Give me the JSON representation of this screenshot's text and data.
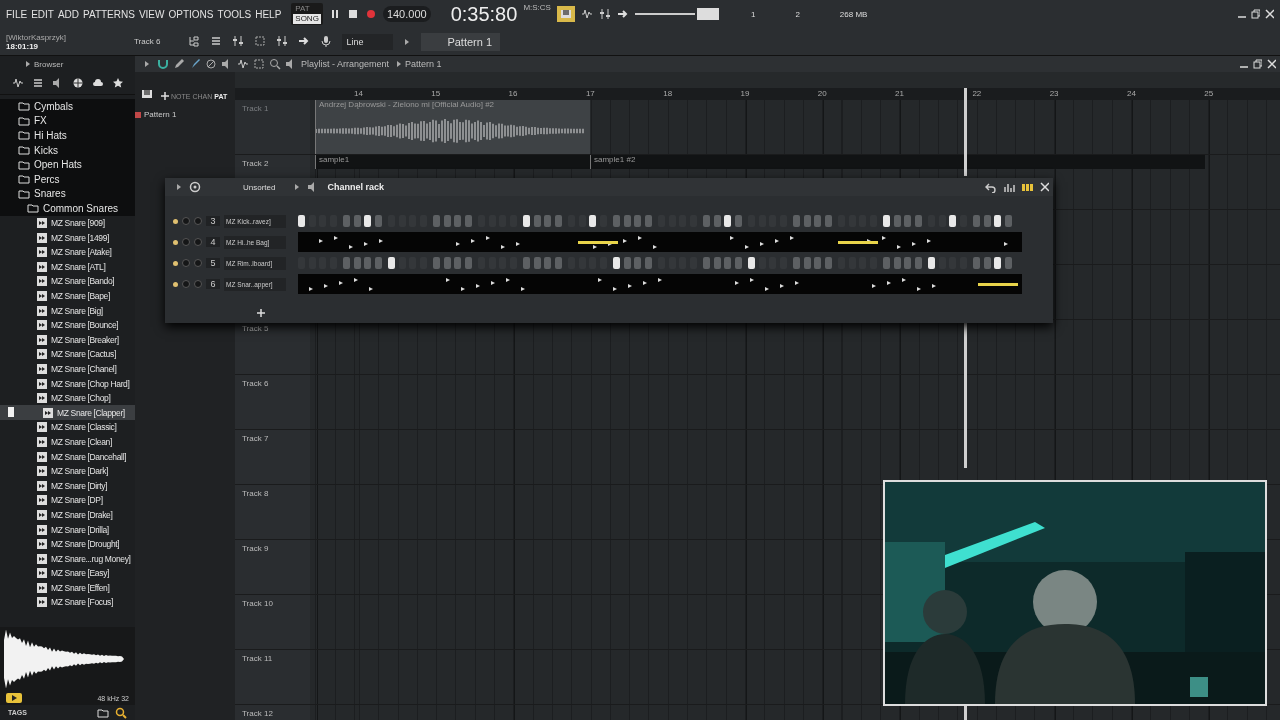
{
  "menu": [
    "FILE",
    "EDIT",
    "ADD",
    "PATTERNS",
    "VIEW",
    "OPTIONS",
    "TOOLS",
    "HELP"
  ],
  "transport": {
    "modes": [
      {
        "label": "PAT",
        "selected": false
      },
      {
        "label": "SONG",
        "selected": true
      }
    ],
    "tempo": "140.000",
    "time": "0:35:80",
    "time_format": "M:S:CS"
  },
  "monitor": {
    "marks": [
      "1",
      "2"
    ],
    "memory": "268 MB"
  },
  "session": {
    "user": "[WiktorKasprzyk]",
    "clock": "18:01:19",
    "focused_track": "Track 6",
    "input": "Line",
    "pattern": "Pattern 1"
  },
  "browser": {
    "title": "Browser",
    "tree": [
      {
        "label": "Cymbals",
        "kind": "folder",
        "selected": false
      },
      {
        "label": "FX",
        "kind": "folder",
        "selected": false
      },
      {
        "label": "Hi Hats",
        "kind": "folder",
        "selected": false
      },
      {
        "label": "Kicks",
        "kind": "folder",
        "selected": false
      },
      {
        "label": "Open Hats",
        "kind": "folder",
        "selected": false
      },
      {
        "label": "Percs",
        "kind": "folder",
        "selected": false
      },
      {
        "label": "Snares",
        "kind": "folder",
        "selected": false,
        "children": [
          {
            "label": "Common Snares",
            "kind": "folder",
            "selected": false,
            "children": [
              {
                "label": "MZ Snare [909]",
                "kind": "file",
                "selected": false
              },
              {
                "label": "MZ Snare [1499]",
                "kind": "file",
                "selected": false
              },
              {
                "label": "MZ Snare [Atake]",
                "kind": "file",
                "selected": false
              },
              {
                "label": "MZ Snare [ATL]",
                "kind": "file",
                "selected": false
              },
              {
                "label": "MZ Snare [Bando]",
                "kind": "file",
                "selected": false
              },
              {
                "label": "MZ Snare [Bape]",
                "kind": "file",
                "selected": false
              },
              {
                "label": "MZ Snare [Big]",
                "kind": "file",
                "selected": false
              },
              {
                "label": "MZ Snare [Bounce]",
                "kind": "file",
                "selected": false
              },
              {
                "label": "MZ Snare [Breaker]",
                "kind": "file",
                "selected": false
              },
              {
                "label": "MZ Snare [Cactus]",
                "kind": "file",
                "selected": false
              },
              {
                "label": "MZ Snare [Chanel]",
                "kind": "file",
                "selected": false
              },
              {
                "label": "MZ Snare [Chop Hard]",
                "kind": "file",
                "selected": false
              },
              {
                "label": "MZ Snare [Chop]",
                "kind": "file",
                "selected": false
              },
              {
                "label": "MZ Snare [Clapper]",
                "kind": "file",
                "selected": true
              },
              {
                "label": "MZ Snare [Classic]",
                "kind": "file",
                "selected": false
              },
              {
                "label": "MZ Snare [Clean]",
                "kind": "file",
                "selected": false
              },
              {
                "label": "MZ Snare [Dancehall]",
                "kind": "file",
                "selected": false
              },
              {
                "label": "MZ Snare [Dark]",
                "kind": "file",
                "selected": false
              },
              {
                "label": "MZ Snare [Dirty]",
                "kind": "file",
                "selected": false
              },
              {
                "label": "MZ Snare [DP]",
                "kind": "file",
                "selected": false
              },
              {
                "label": "MZ Snare [Drake]",
                "kind": "file",
                "selected": false
              },
              {
                "label": "MZ Snare [Drilla]",
                "kind": "file",
                "selected": false
              },
              {
                "label": "MZ Snare [Drought]",
                "kind": "file",
                "selected": false
              },
              {
                "label": "MZ Snare...rug Money]",
                "kind": "file",
                "selected": false
              },
              {
                "label": "MZ Snare [Easy]",
                "kind": "file",
                "selected": false
              },
              {
                "label": "MZ Snare [Effen]",
                "kind": "file",
                "selected": false
              },
              {
                "label": "MZ Snare [Focus]",
                "kind": "file",
                "selected": false
              }
            ]
          }
        ]
      }
    ],
    "sample_info": "48 kHz 32",
    "tags": "TAGS"
  },
  "playlist": {
    "title": "Playlist - Arrangement",
    "pattern": "Pattern 1",
    "view_modes": [
      {
        "label": "NOTE",
        "selected": false
      },
      {
        "label": "CHAN",
        "selected": false
      },
      {
        "label": "PAT",
        "selected": true
      }
    ],
    "patterns": [
      {
        "label": "Pattern 1"
      }
    ],
    "ruler": [
      "14",
      "15",
      "16",
      "17",
      "18",
      "19",
      "20",
      "21",
      "22",
      "23",
      "24",
      "25"
    ],
    "tracks": [
      {
        "label": "Track 1",
        "kind": "track",
        "muted": true,
        "clips": [
          {
            "label": "Andrzej Dąbrowski - Zielono mi [Official Audio] #2",
            "kind": "audio"
          }
        ]
      },
      {
        "label": "Track 2",
        "kind": "track",
        "muted": false,
        "clips": [
          {
            "label": "sample1",
            "kind": "sample"
          },
          {
            "label": "sample1 #2",
            "kind": "sample"
          }
        ]
      },
      {
        "kind": "track"
      },
      {
        "kind": "track"
      },
      {
        "label": "Track 5",
        "kind": "track",
        "muted": false
      },
      {
        "label": "Track 6",
        "kind": "track",
        "muted": false
      },
      {
        "label": "Track 7",
        "kind": "track",
        "muted": false
      },
      {
        "label": "Track 8",
        "kind": "track",
        "muted": false
      },
      {
        "label": "Track 9",
        "kind": "track",
        "muted": false
      },
      {
        "label": "Track 10",
        "kind": "track",
        "muted": false
      },
      {
        "label": "Track 11",
        "kind": "track",
        "muted": false
      },
      {
        "label": "Track 12",
        "kind": "track",
        "muted": false
      }
    ]
  },
  "channel_rack": {
    "filter": "Unsorted",
    "title": "Channel rack",
    "channels": [
      {
        "number": "3",
        "name": "MZ Kick..ravez]",
        "kind": "steps",
        "steps": [
          true,
          false,
          false,
          false,
          false,
          false,
          true,
          false,
          false,
          false,
          false,
          false,
          false,
          false,
          false,
          false,
          false,
          false,
          false,
          false,
          true,
          false,
          false,
          false,
          false,
          false,
          true,
          false,
          false,
          false,
          false,
          false,
          false,
          false,
          false,
          false,
          false,
          false,
          true,
          false,
          false,
          false,
          false,
          false,
          false,
          false,
          false,
          false,
          false,
          false,
          false,
          false,
          true,
          false,
          false,
          false,
          false,
          false,
          true,
          false,
          false,
          false,
          true,
          false
        ]
      },
      {
        "number": "4",
        "name": "MZ Hi..he Bag]",
        "kind": "notes"
      },
      {
        "number": "5",
        "name": "MZ Rim..lboard]",
        "kind": "steps",
        "steps": [
          false,
          false,
          false,
          false,
          false,
          false,
          false,
          false,
          true,
          false,
          false,
          false,
          false,
          false,
          false,
          false,
          false,
          false,
          false,
          false,
          false,
          false,
          false,
          false,
          false,
          false,
          false,
          false,
          true,
          false,
          false,
          false,
          false,
          false,
          false,
          false,
          false,
          false,
          false,
          false,
          true,
          false,
          false,
          false,
          false,
          false,
          false,
          false,
          false,
          false,
          false,
          false,
          false,
          false,
          false,
          false,
          true,
          false,
          false,
          false,
          false,
          false,
          true,
          false
        ]
      },
      {
        "number": "6",
        "name": "MZ Snar..apper]",
        "kind": "notes"
      }
    ]
  }
}
